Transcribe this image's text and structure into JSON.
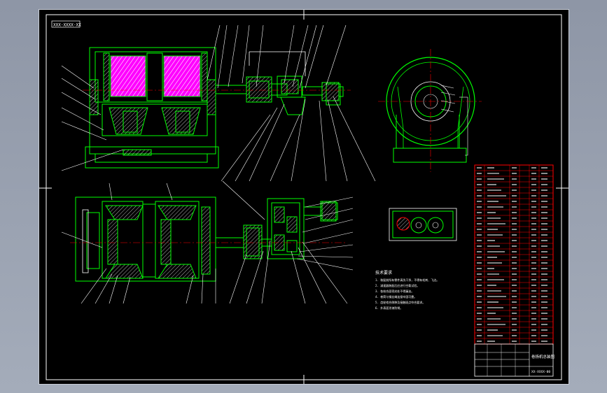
{
  "drawing": {
    "code_label": "XXX-XXXX-XX",
    "notes_title": "技术要求",
    "notes": [
      "1. 装配前所有零件清洗干净，不得有毛刺、飞边。",
      "2. 减速器装配后应进行空载试验。",
      "3. 各结合面密封处不得漏油。",
      "4. 卷筒与钢丝绳连接牢固可靠。",
      "5. 齿轮啮合侧隙及接触斑点符合要求。",
      "6. 外表面涂漆防锈。"
    ],
    "title_block": {
      "name": "卷扬机总装图",
      "code": "XX-XXXX-00"
    }
  },
  "colors": {
    "outline": "#00ff00",
    "center": "#ff0000",
    "annotation": "#ffffff",
    "hatch": "#ff00ff",
    "table_border": "#ff0000",
    "background": "#000000"
  }
}
